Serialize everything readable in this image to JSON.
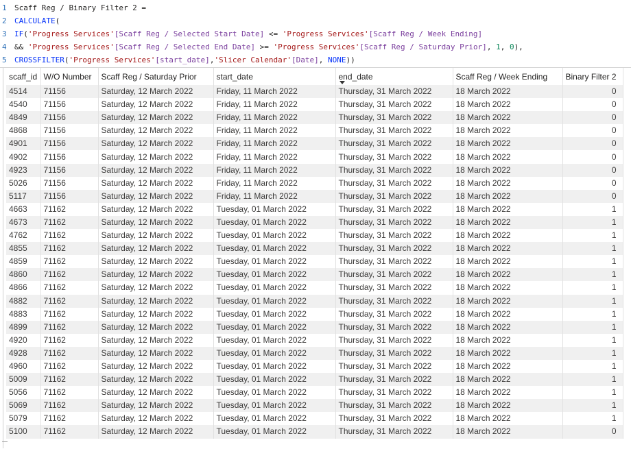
{
  "formula": {
    "lines": [
      {
        "n": "1",
        "parts": [
          [
            "p",
            "Scaff Reg / Binary Filter 2 ="
          ]
        ]
      },
      {
        "n": "2",
        "parts": [
          [
            "k",
            "CALCULATE"
          ],
          [
            "p",
            "("
          ]
        ]
      },
      {
        "n": "3",
        "parts": [
          [
            "k",
            "IF"
          ],
          [
            "p",
            "("
          ],
          [
            "s",
            "'Progress Services'"
          ],
          [
            "c",
            "[Scaff Reg / Selected Start Date]"
          ],
          [
            "p",
            " <= "
          ],
          [
            "s",
            "'Progress Services'"
          ],
          [
            "c",
            "[Scaff Reg / Week Ending]"
          ]
        ]
      },
      {
        "n": "4",
        "parts": [
          [
            "p",
            "&& "
          ],
          [
            "s",
            "'Progress Services'"
          ],
          [
            "c",
            "[Scaff Reg / Selected End Date]"
          ],
          [
            "p",
            " >= "
          ],
          [
            "s",
            "'Progress Services'"
          ],
          [
            "c",
            "[Scaff Reg / Saturday Prior]"
          ],
          [
            "p",
            ", "
          ],
          [
            "n",
            "1"
          ],
          [
            "p",
            ", "
          ],
          [
            "n",
            "0"
          ],
          [
            "p",
            "),"
          ]
        ]
      },
      {
        "n": "5",
        "parts": [
          [
            "k",
            "CROSSFILTER"
          ],
          [
            "p",
            "("
          ],
          [
            "s",
            "'Progress Services'"
          ],
          [
            "c",
            "[start_date]"
          ],
          [
            "p",
            ","
          ],
          [
            "s",
            "'Slicer Calendar'"
          ],
          [
            "c",
            "[Date]"
          ],
          [
            "p",
            ", "
          ],
          [
            "k",
            "NONE"
          ],
          [
            "p",
            "))"
          ]
        ]
      }
    ]
  },
  "table": {
    "columns": [
      "scaff_id",
      "W/O Number",
      "Scaff Reg / Saturday Prior",
      "start_date",
      "end_date",
      "Scaff Reg / Week Ending",
      "Binary Filter 2"
    ],
    "sorted_column": "end_date",
    "rows": [
      [
        "4514",
        "71156",
        "Saturday, 12 March 2022",
        "Friday, 11 March 2022",
        "Thursday, 31 March 2022",
        "18 March 2022",
        "0"
      ],
      [
        "4540",
        "71156",
        "Saturday, 12 March 2022",
        "Friday, 11 March 2022",
        "Thursday, 31 March 2022",
        "18 March 2022",
        "0"
      ],
      [
        "4849",
        "71156",
        "Saturday, 12 March 2022",
        "Friday, 11 March 2022",
        "Thursday, 31 March 2022",
        "18 March 2022",
        "0"
      ],
      [
        "4868",
        "71156",
        "Saturday, 12 March 2022",
        "Friday, 11 March 2022",
        "Thursday, 31 March 2022",
        "18 March 2022",
        "0"
      ],
      [
        "4901",
        "71156",
        "Saturday, 12 March 2022",
        "Friday, 11 March 2022",
        "Thursday, 31 March 2022",
        "18 March 2022",
        "0"
      ],
      [
        "4902",
        "71156",
        "Saturday, 12 March 2022",
        "Friday, 11 March 2022",
        "Thursday, 31 March 2022",
        "18 March 2022",
        "0"
      ],
      [
        "4923",
        "71156",
        "Saturday, 12 March 2022",
        "Friday, 11 March 2022",
        "Thursday, 31 March 2022",
        "18 March 2022",
        "0"
      ],
      [
        "5026",
        "71156",
        "Saturday, 12 March 2022",
        "Friday, 11 March 2022",
        "Thursday, 31 March 2022",
        "18 March 2022",
        "0"
      ],
      [
        "5117",
        "71156",
        "Saturday, 12 March 2022",
        "Friday, 11 March 2022",
        "Thursday, 31 March 2022",
        "18 March 2022",
        "0"
      ],
      [
        "4663",
        "71162",
        "Saturday, 12 March 2022",
        "Tuesday, 01 March 2022",
        "Thursday, 31 March 2022",
        "18 March 2022",
        "1"
      ],
      [
        "4673",
        "71162",
        "Saturday, 12 March 2022",
        "Tuesday, 01 March 2022",
        "Thursday, 31 March 2022",
        "18 March 2022",
        "1"
      ],
      [
        "4762",
        "71162",
        "Saturday, 12 March 2022",
        "Tuesday, 01 March 2022",
        "Thursday, 31 March 2022",
        "18 March 2022",
        "1"
      ],
      [
        "4855",
        "71162",
        "Saturday, 12 March 2022",
        "Tuesday, 01 March 2022",
        "Thursday, 31 March 2022",
        "18 March 2022",
        "1"
      ],
      [
        "4859",
        "71162",
        "Saturday, 12 March 2022",
        "Tuesday, 01 March 2022",
        "Thursday, 31 March 2022",
        "18 March 2022",
        "1"
      ],
      [
        "4860",
        "71162",
        "Saturday, 12 March 2022",
        "Tuesday, 01 March 2022",
        "Thursday, 31 March 2022",
        "18 March 2022",
        "1"
      ],
      [
        "4866",
        "71162",
        "Saturday, 12 March 2022",
        "Tuesday, 01 March 2022",
        "Thursday, 31 March 2022",
        "18 March 2022",
        "1"
      ],
      [
        "4882",
        "71162",
        "Saturday, 12 March 2022",
        "Tuesday, 01 March 2022",
        "Thursday, 31 March 2022",
        "18 March 2022",
        "1"
      ],
      [
        "4883",
        "71162",
        "Saturday, 12 March 2022",
        "Tuesday, 01 March 2022",
        "Thursday, 31 March 2022",
        "18 March 2022",
        "1"
      ],
      [
        "4899",
        "71162",
        "Saturday, 12 March 2022",
        "Tuesday, 01 March 2022",
        "Thursday, 31 March 2022",
        "18 March 2022",
        "1"
      ],
      [
        "4920",
        "71162",
        "Saturday, 12 March 2022",
        "Tuesday, 01 March 2022",
        "Thursday, 31 March 2022",
        "18 March 2022",
        "1"
      ],
      [
        "4928",
        "71162",
        "Saturday, 12 March 2022",
        "Tuesday, 01 March 2022",
        "Thursday, 31 March 2022",
        "18 March 2022",
        "1"
      ],
      [
        "4960",
        "71162",
        "Saturday, 12 March 2022",
        "Tuesday, 01 March 2022",
        "Thursday, 31 March 2022",
        "18 March 2022",
        "1"
      ],
      [
        "5009",
        "71162",
        "Saturday, 12 March 2022",
        "Tuesday, 01 March 2022",
        "Thursday, 31 March 2022",
        "18 March 2022",
        "1"
      ],
      [
        "5056",
        "71162",
        "Saturday, 12 March 2022",
        "Tuesday, 01 March 2022",
        "Thursday, 31 March 2022",
        "18 March 2022",
        "1"
      ],
      [
        "5069",
        "71162",
        "Saturday, 12 March 2022",
        "Tuesday, 01 March 2022",
        "Thursday, 31 March 2022",
        "18 March 2022",
        "1"
      ],
      [
        "5079",
        "71162",
        "Saturday, 12 March 2022",
        "Tuesday, 01 March 2022",
        "Thursday, 31 March 2022",
        "18 March 2022",
        "1"
      ],
      [
        "5100",
        "71162",
        "Saturday, 12 March 2022",
        "Tuesday, 01 March 2022",
        "Thursday, 31 March 2022",
        "18 March 2022",
        "0"
      ]
    ]
  },
  "colors": {
    "keyword": "#0431fa",
    "string": "#a31515",
    "column": "#7a3e9d",
    "number": "#098658",
    "alt_row": "#f0f0f0"
  }
}
